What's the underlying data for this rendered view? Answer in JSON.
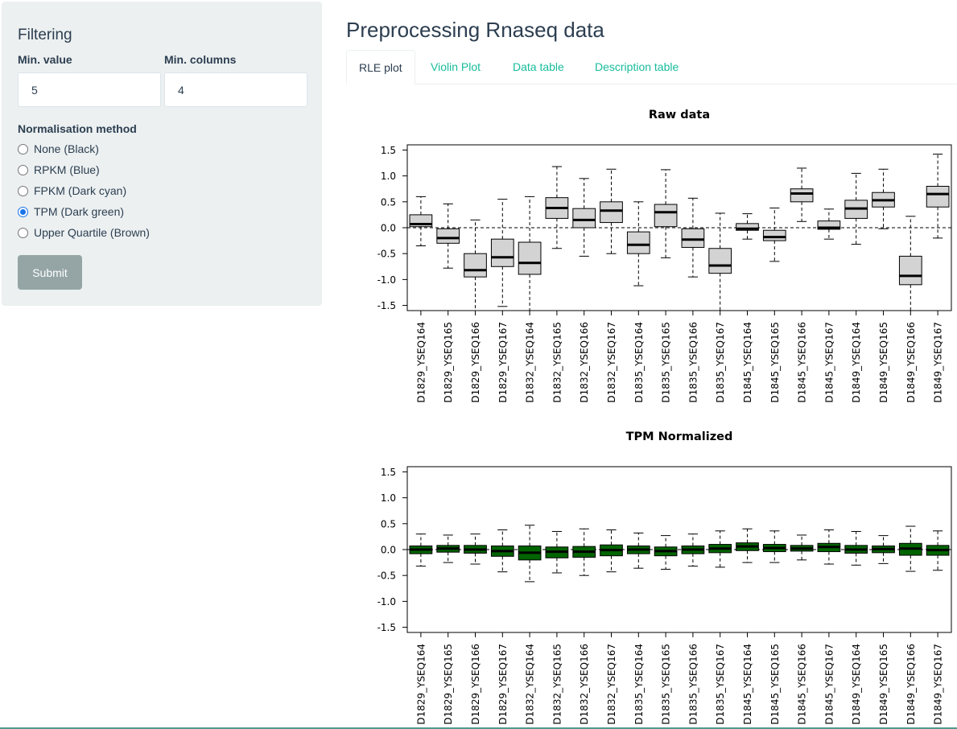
{
  "sidebar": {
    "title": "Filtering",
    "min_value_label": "Min. value",
    "min_value": "5",
    "min_columns_label": "Min. columns",
    "min_columns": "4",
    "radio_heading": "Normalisation method",
    "options": [
      "None (Black)",
      "RPKM (Blue)",
      "FPKM (Dark cyan)",
      "TPM (Dark green)",
      "Upper Quartile (Brown)"
    ],
    "selected_option": "TPM (Dark green)",
    "submit_label": "Submit"
  },
  "main": {
    "title": "Preprocessing Rnaseq data",
    "tabs": [
      "RLE plot",
      "Violin Plot",
      "Data table",
      "Description table"
    ],
    "active_tab": "RLE plot"
  },
  "chart_data": [
    {
      "type": "box",
      "title": "Raw data",
      "fill_color": "#d3d3d3",
      "categories": [
        "D1829_YSEQ164",
        "D1829_YSEQ165",
        "D1829_YSEQ166",
        "D1829_YSEQ167",
        "D1832_YSEQ164",
        "D1832_YSEQ165",
        "D1832_YSEQ166",
        "D1832_YSEQ167",
        "D1835_YSEQ164",
        "D1835_YSEQ165",
        "D1835_YSEQ166",
        "D1835_YSEQ167",
        "D1845_YSEQ164",
        "D1845_YSEQ165",
        "D1845_YSEQ166",
        "D1845_YSEQ167",
        "D1849_YSEQ164",
        "D1849_YSEQ165",
        "D1849_YSEQ166",
        "D1849_YSEQ167"
      ],
      "whisker_low": [
        -0.35,
        -0.78,
        -1.6,
        -1.52,
        -1.6,
        -0.4,
        -0.55,
        -0.5,
        -1.12,
        -0.58,
        -0.95,
        -1.6,
        -0.22,
        -0.65,
        0.12,
        -0.22,
        -0.32,
        -0.02,
        -1.6,
        -0.2
      ],
      "q1": [
        0.02,
        -0.3,
        -0.95,
        -0.75,
        -0.9,
        0.18,
        0.0,
        0.1,
        -0.5,
        0.02,
        -0.38,
        -0.88,
        -0.05,
        -0.25,
        0.5,
        -0.03,
        0.18,
        0.4,
        -1.1,
        0.4
      ],
      "median": [
        0.07,
        -0.2,
        -0.82,
        -0.57,
        -0.68,
        0.38,
        0.15,
        0.33,
        -0.33,
        0.3,
        -0.23,
        -0.73,
        -0.02,
        -0.18,
        0.66,
        0.0,
        0.37,
        0.53,
        -0.93,
        0.65
      ],
      "q3": [
        0.25,
        -0.02,
        -0.5,
        -0.22,
        -0.28,
        0.58,
        0.37,
        0.5,
        -0.08,
        0.45,
        -0.02,
        -0.4,
        0.08,
        -0.05,
        0.75,
        0.13,
        0.53,
        0.68,
        -0.55,
        0.8
      ],
      "whisker_high": [
        0.6,
        0.46,
        0.15,
        0.55,
        0.6,
        1.18,
        0.95,
        1.13,
        0.5,
        1.12,
        0.57,
        0.28,
        0.27,
        0.38,
        1.15,
        0.36,
        1.05,
        1.13,
        0.22,
        1.42
      ],
      "ylim": [
        -1.6,
        1.6
      ],
      "yticks": [
        -1.5,
        -1.0,
        -0.5,
        0.0,
        0.5,
        1.0,
        1.5
      ]
    },
    {
      "type": "box",
      "title": "TPM Normalized",
      "fill_color": "#006400",
      "categories": [
        "D1829_YSEQ164",
        "D1829_YSEQ165",
        "D1829_YSEQ166",
        "D1829_YSEQ167",
        "D1832_YSEQ164",
        "D1832_YSEQ165",
        "D1832_YSEQ166",
        "D1832_YSEQ167",
        "D1835_YSEQ164",
        "D1835_YSEQ165",
        "D1835_YSEQ166",
        "D1835_YSEQ167",
        "D1845_YSEQ164",
        "D1845_YSEQ165",
        "D1845_YSEQ166",
        "D1845_YSEQ167",
        "D1849_YSEQ164",
        "D1849_YSEQ165",
        "D1849_YSEQ166",
        "D1849_YSEQ167"
      ],
      "whisker_low": [
        -0.32,
        -0.25,
        -0.28,
        -0.43,
        -0.62,
        -0.45,
        -0.5,
        -0.43,
        -0.36,
        -0.38,
        -0.32,
        -0.34,
        -0.25,
        -0.25,
        -0.2,
        -0.28,
        -0.3,
        -0.27,
        -0.42,
        -0.4
      ],
      "q1": [
        -0.08,
        -0.05,
        -0.07,
        -0.13,
        -0.2,
        -0.16,
        -0.15,
        -0.12,
        -0.08,
        -0.12,
        -0.08,
        -0.06,
        -0.02,
        -0.04,
        -0.03,
        -0.04,
        -0.07,
        -0.06,
        -0.11,
        -0.11
      ],
      "median": [
        0.0,
        0.02,
        0.0,
        -0.03,
        -0.06,
        -0.04,
        -0.04,
        -0.01,
        0.0,
        -0.03,
        0.0,
        0.02,
        0.06,
        0.03,
        0.02,
        0.05,
        0.0,
        0.01,
        0.02,
        -0.01
      ],
      "q3": [
        0.07,
        0.08,
        0.08,
        0.07,
        0.07,
        0.05,
        0.06,
        0.09,
        0.07,
        0.05,
        0.07,
        0.1,
        0.13,
        0.1,
        0.08,
        0.12,
        0.08,
        0.07,
        0.12,
        0.08
      ],
      "whisker_high": [
        0.3,
        0.28,
        0.3,
        0.38,
        0.47,
        0.35,
        0.4,
        0.38,
        0.32,
        0.27,
        0.3,
        0.36,
        0.4,
        0.36,
        0.28,
        0.38,
        0.35,
        0.27,
        0.45,
        0.36
      ],
      "ylim": [
        -1.6,
        1.6
      ],
      "yticks": [
        -1.5,
        -1.0,
        -0.5,
        0.0,
        0.5,
        1.0,
        1.5
      ]
    }
  ]
}
